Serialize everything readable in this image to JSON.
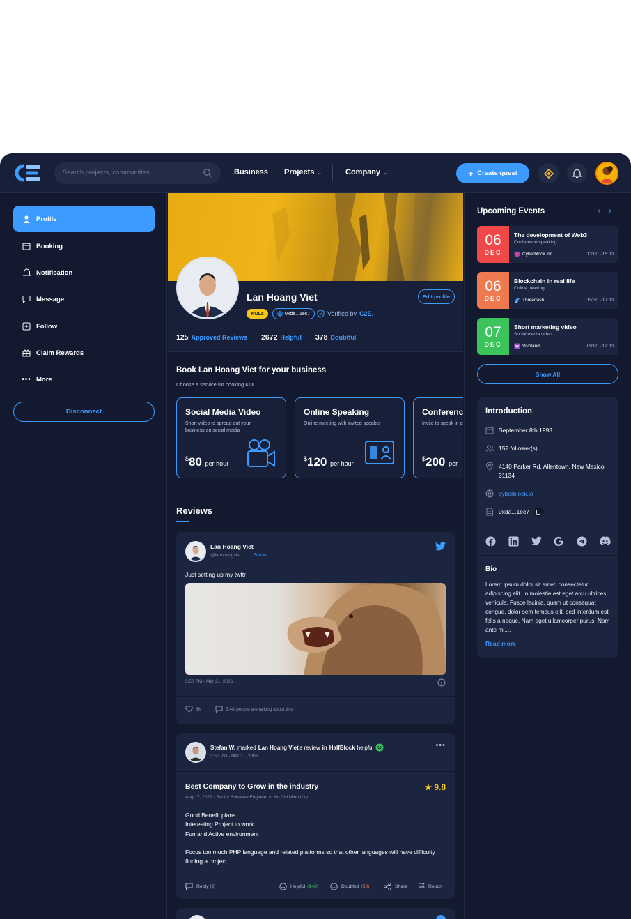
{
  "header": {
    "search_placeholder": "Search projects, communities ..",
    "nav": [
      {
        "label": "Business",
        "has_dropdown": false
      },
      {
        "label": "Projects",
        "has_dropdown": true
      },
      {
        "label": "Company",
        "has_dropdown": true
      }
    ],
    "create_label": "Create quest",
    "accent": "#3b9bff"
  },
  "sidebar": {
    "items": [
      {
        "label": "Profile",
        "icon": "user-icon",
        "active": true
      },
      {
        "label": "Booking",
        "icon": "calendar-icon",
        "active": false
      },
      {
        "label": "Notification",
        "icon": "bell-icon",
        "active": false
      },
      {
        "label": "Message",
        "icon": "message-icon",
        "active": false
      },
      {
        "label": "Follow",
        "icon": "plus-square-icon",
        "active": false
      },
      {
        "label": "Claim Rewards",
        "icon": "gift-icon",
        "active": false
      },
      {
        "label": "More",
        "icon": "dots-icon",
        "active": false
      }
    ],
    "disconnect_label": "Disconnect"
  },
  "profile": {
    "name": "Lan Hoang Viet",
    "edit_label": "Edit profile",
    "badge": "KOLs",
    "address": "0xda...1ec7",
    "verified_prefix": "Verified by",
    "verified_by": "C2E.",
    "stats": [
      {
        "value": "125",
        "label": "Approved Reviews"
      },
      {
        "value": "2672",
        "label": "Helpful"
      },
      {
        "value": "378",
        "label": "Doubtful"
      }
    ]
  },
  "booking": {
    "title": "Book Lan Hoang Viet for your business",
    "subtitle": "Choose a service for booking KOL",
    "services": [
      {
        "title": "Social Media Video",
        "desc": "Short video to spread out your business on social media",
        "currency": "$",
        "price": "80",
        "unit": "per hour",
        "icon": "video-camera-icon"
      },
      {
        "title": "Online Speaking",
        "desc": "Online meeting with invited speaker",
        "currency": "$",
        "price": "120",
        "unit": "per hour",
        "icon": "presentation-icon"
      },
      {
        "title": "Conference",
        "desc": "Invite to speak in audience",
        "currency": "$",
        "price": "200",
        "unit": "per",
        "icon": "conference-icon"
      }
    ]
  },
  "reviews": {
    "title": "Reviews",
    "tweet": {
      "author": "Lan Hoang Viet",
      "handle": "@lanhoangviet",
      "follow": "Follow",
      "text": "Just setting up my twttr",
      "time": "3:50 PM - Mar 21, 2006",
      "likes": "6K",
      "talking": "5.4K people are talking about this"
    },
    "review": {
      "actor": "Stefan W.",
      "action": "marked",
      "target": "Lan Hoang Viet",
      "middle": "'s review",
      "place_prefix": "in",
      "place": "HalfBlock",
      "suffix": "helpful",
      "time": "3:50 PM - Mar 21, 2006",
      "title": "Best Company to Grow in the industry",
      "rating": "9.8",
      "meta": "Aug 17, 2022 - Senior Software Engineer in Ho Chi Minh City",
      "pros": [
        "Good Benefit plans",
        "Interesting Project to work",
        "Fun and Active environment"
      ],
      "cons": "Focus too much PHP language and related platforms so that other languages will have difficulty finding a project.",
      "reply": "Reply (2)",
      "helpful_label": "Helpful",
      "helpful_count": "(143)",
      "doubtful_label": "Doubtful",
      "doubtful_count": "(50)",
      "share": "Share",
      "report": "Report"
    }
  },
  "events": {
    "title": "Upcoming Events",
    "items": [
      {
        "day": "06",
        "month": "DEC",
        "color": "#f04848",
        "name": "The development of Web3",
        "sub": "Conference speaking",
        "org": "Cyberblock Inc.",
        "time": "13:00 - 15:00"
      },
      {
        "day": "06",
        "month": "DEC",
        "color": "#f07a50",
        "name": "Blockchain in real life",
        "sub": "Online meeting",
        "org": "Threedash",
        "time": "15:30 - 17:00"
      },
      {
        "day": "07",
        "month": "DEC",
        "color": "#3cc45c",
        "name": "Short marketing video",
        "sub": "Social media video",
        "org": "Vivoland",
        "time": "09:00 - 12:00"
      }
    ],
    "show_all": "Show All"
  },
  "intro": {
    "title": "Introduction",
    "birthday": "September 8th 1993",
    "followers": "152 follower(s)",
    "address": "4140 Parker Rd. Allentown, New Mexico 31134",
    "website": "cyberblock.io",
    "wallet": "0xda...1ec7",
    "socials": [
      "facebook-icon",
      "linkedin-icon",
      "twitter-icon",
      "google-icon",
      "telegram-icon",
      "discord-icon"
    ],
    "bio_title": "Bio",
    "bio": "Lorem ipsum dolor sit amet, consectetur adipiscing elit. In molestie est eget arcu ultrices vehicula. Fusce lacinia, quam ut consequat congue, dolor sem tempus elit, sed interdum est felis a neque. Nam eget ullamcorper purus. Nam ante mi,...",
    "read_more": "Read more"
  }
}
